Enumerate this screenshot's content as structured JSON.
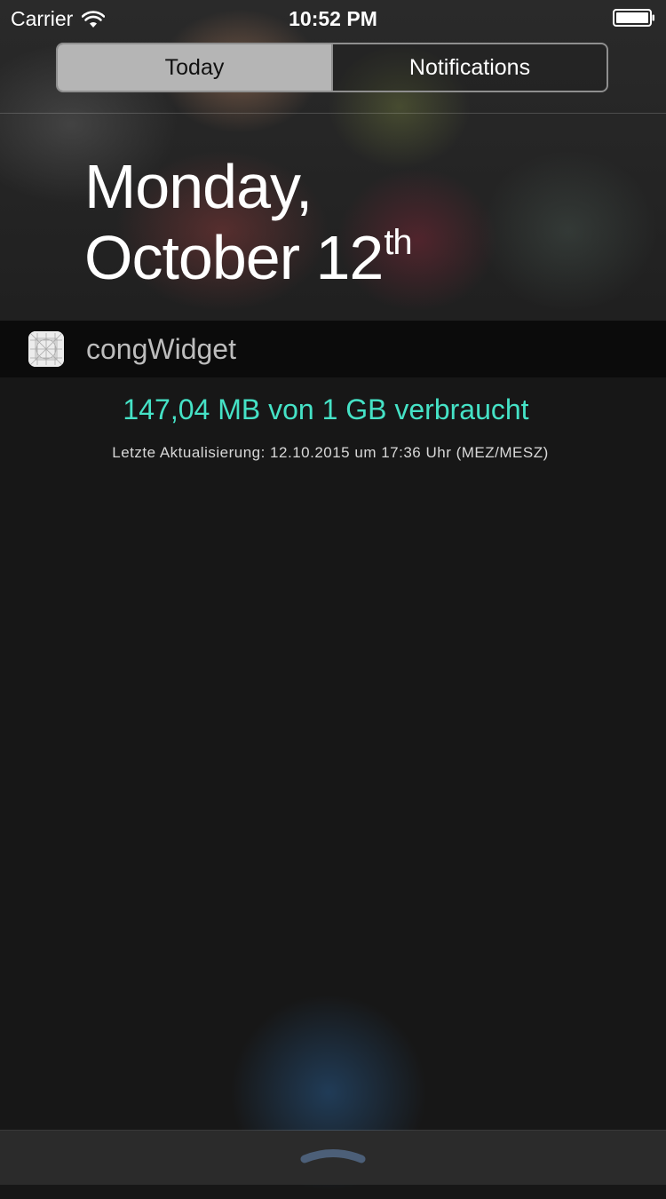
{
  "status_bar": {
    "carrier": "Carrier",
    "time": "10:52 PM",
    "icons": [
      "wifi-icon",
      "battery-icon"
    ]
  },
  "segmented_control": {
    "tabs": [
      {
        "label": "Today",
        "selected": true
      },
      {
        "label": "Notifications",
        "selected": false
      }
    ]
  },
  "date": {
    "line1": "Monday,",
    "line2": "October 12",
    "suffix": "th"
  },
  "widget": {
    "app_icon": "grid-app-icon",
    "name": "congWidget",
    "usage": "147,04 MB von 1 GB verbraucht",
    "last_updated": "Letzte Aktualisierung: 12.10.2015 um 17:36 Uhr (MEZ/MESZ)"
  },
  "bottom": {
    "icon": "chevron-up-grabber-icon"
  },
  "colors": {
    "accent_text": "#45e2c6",
    "active_segment": "#b5b5b5"
  }
}
